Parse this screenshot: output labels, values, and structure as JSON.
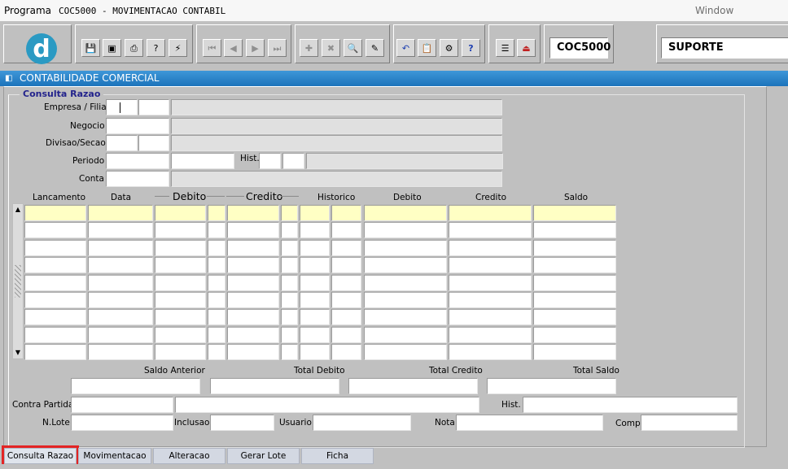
{
  "menubar": {
    "program": "Programa",
    "title": "COC5000 - MOVIMENTACAO CONTABIL",
    "window": "Window"
  },
  "toolbar": {
    "icons": [
      "save-icon",
      "window-icon",
      "print-icon",
      "help-query-icon",
      "wizard-icon",
      "first-record-icon",
      "prev-record-icon",
      "next-record-icon",
      "last-record-icon",
      "insert-record-icon",
      "delete-record-icon",
      "query-icon",
      "clear-icon",
      "undo-icon",
      "clipboard-icon",
      "tools-icon",
      "help-icon",
      "menu-icon",
      "exit-icon"
    ],
    "program_code": "COC5000",
    "user": "SUPORTE"
  },
  "window_title": "CONTABILIDADE COMERCIAL",
  "form": {
    "legend": "Consulta Razao",
    "labels": {
      "empresa": "Empresa / Filial",
      "negocio": "Negocio",
      "divisao": "Divisao/Secao",
      "periodo": "Periodo",
      "hist": "Hist.",
      "conta": "Conta"
    }
  },
  "grid": {
    "headers": {
      "lancamento": "Lancamento",
      "data": "Data",
      "debito_group": "Debito",
      "credito_group": "Credito",
      "historico": "Historico",
      "debito": "Debito",
      "credito": "Credito",
      "saldo": "Saldo"
    },
    "row_count": 9
  },
  "totals": {
    "saldo_anterior": "Saldo Anterior",
    "total_debito": "Total Debito",
    "total_credito": "Total Credito",
    "total_saldo": "Total Saldo"
  },
  "footer_labels": {
    "contra_partida": "Contra Partida",
    "hist": "Hist.",
    "n_lote": "N.Lote",
    "inclusao": "Inclusao",
    "usuario": "Usuario",
    "nota": "Nota",
    "comp": "Comp"
  },
  "tabs": [
    "Consulta Razao",
    "Movimentacao",
    "Alteracao",
    "Gerar Lote",
    "Ficha"
  ],
  "active_tab": "Consulta Razao",
  "colors": {
    "title_bar": "#1c73bb",
    "current_row": "#ffffc4",
    "active_tab_highlight": "#e32424",
    "legend": "#23238c"
  }
}
